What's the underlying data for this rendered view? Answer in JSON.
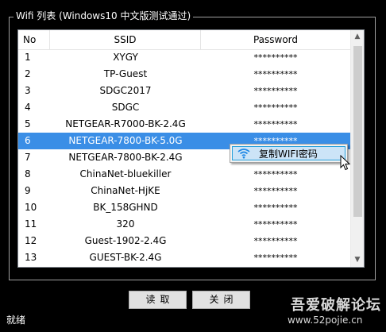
{
  "group": {
    "title": "Wifi 列表 (Windows10 中文版测试通过)"
  },
  "list": {
    "columns": {
      "no": "No",
      "ssid": "SSID",
      "password": "Password"
    },
    "rows": [
      {
        "no": "1",
        "ssid": "XYGY",
        "password": "**********"
      },
      {
        "no": "2",
        "ssid": "TP-Guest",
        "password": "**********"
      },
      {
        "no": "3",
        "ssid": "SDGC2017",
        "password": "**********"
      },
      {
        "no": "4",
        "ssid": "SDGC",
        "password": "**********"
      },
      {
        "no": "5",
        "ssid": "NETGEAR-R7000-BK-2.4G",
        "password": "**********"
      },
      {
        "no": "6",
        "ssid": "NETGEAR-7800-BK-5.0G",
        "password": "**********"
      },
      {
        "no": "7",
        "ssid": "NETGEAR-7800-BK-2.4G",
        "password": "**********"
      },
      {
        "no": "8",
        "ssid": "ChinaNet-bluekiller",
        "password": "**********"
      },
      {
        "no": "9",
        "ssid": "ChinaNet-HjKE",
        "password": "**********"
      },
      {
        "no": "10",
        "ssid": "BK_158GHND",
        "password": "**********"
      },
      {
        "no": "11",
        "ssid": "320",
        "password": "**********"
      },
      {
        "no": "12",
        "ssid": "Guest-1902-2.4G",
        "password": "**********"
      },
      {
        "no": "13",
        "ssid": "GUEST-BK-2.4G",
        "password": "**********"
      }
    ],
    "selected_no": "6"
  },
  "context_menu": {
    "item_label": "复制WIFI密码",
    "item_icon": "wifi-icon"
  },
  "buttons": {
    "read": "读取",
    "close": "关闭"
  },
  "status": {
    "text": "就绪"
  },
  "watermark": {
    "title": "吾爱破解论坛",
    "url": "www.52pojie.cn"
  },
  "colors": {
    "selection": "#3a8ee6",
    "menu_highlight": "#cce4f7",
    "menu_border": "#26a0da",
    "wifi_icon": "#1e88e5"
  }
}
